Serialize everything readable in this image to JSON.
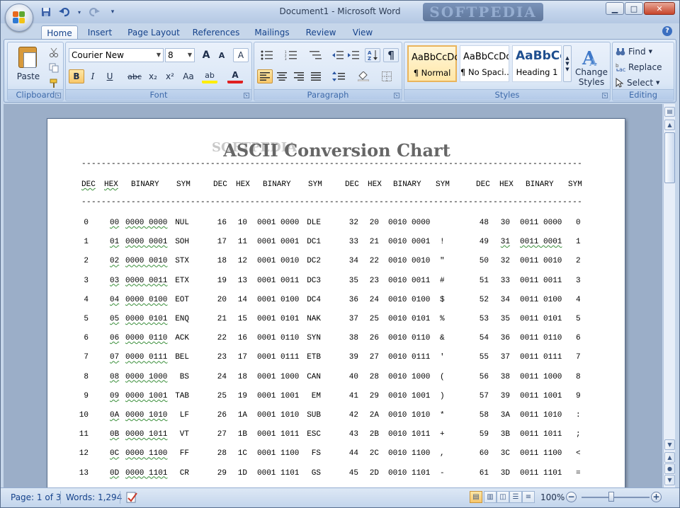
{
  "window": {
    "title": "Document1 - Microsoft Word",
    "watermark": "SOFTPEDIA",
    "controls": {
      "minimize": "▁",
      "maximize": "□",
      "close": "✕"
    }
  },
  "quick_access": {
    "save": "save-icon",
    "undo": "undo-icon",
    "redo": "redo-icon",
    "more": "▾"
  },
  "tabs": [
    "Home",
    "Insert",
    "Page Layout",
    "References",
    "Mailings",
    "Review",
    "View"
  ],
  "help": "?",
  "ribbon": {
    "clipboard": {
      "paste_label": "Paste",
      "group_label": "Clipboard"
    },
    "font": {
      "font_name": "Courier New",
      "font_size": "8",
      "grow": "A",
      "shrink": "A",
      "clear": "A",
      "bold": "B",
      "italic": "I",
      "underline": "U",
      "strike": "abc",
      "subscript": "x₂",
      "superscript": "x²",
      "change_case": "Aa",
      "highlight": "ab",
      "font_color": "A",
      "group_label": "Font"
    },
    "paragraph": {
      "pilcrow": "¶",
      "group_label": "Paragraph"
    },
    "styles": {
      "items": [
        {
          "sample": "AaBbCcDc",
          "name": "¶ Normal"
        },
        {
          "sample": "AaBbCcDc",
          "name": "¶ No Spaci..."
        },
        {
          "sample": "AaBbCc",
          "name": "Heading 1"
        }
      ],
      "change_styles": "Change Styles",
      "change_styles_line1": "Change",
      "change_styles_line2": "Styles",
      "group_label": "Styles"
    },
    "editing": {
      "find": "Find",
      "replace": "Replace",
      "select": "Select",
      "group_label": "Editing"
    }
  },
  "document": {
    "page_watermark": "SOFTPEDIA",
    "title": "ASCII Conversion Chart",
    "header": [
      "DEC",
      "HEX",
      "BINARY",
      "SYM",
      "DEC",
      "HEX",
      "BINARY",
      "SYM",
      "DEC",
      "HEX",
      "BINARY",
      "SYM",
      "DEC",
      "HEX",
      "BINARY",
      "SYM"
    ],
    "rows": [
      [
        "0",
        "00",
        "0000 0000",
        "NUL",
        "16",
        "10",
        "0001 0000",
        "DLE",
        "32",
        "20",
        "0010 0000",
        "",
        "48",
        "30",
        "0011 0000",
        "0"
      ],
      [
        "1",
        "01",
        "0000 0001",
        "SOH",
        "17",
        "11",
        "0001 0001",
        "DC1",
        "33",
        "21",
        "0010 0001",
        "!",
        "49",
        "31",
        "0011 0001",
        "1"
      ],
      [
        "2",
        "02",
        "0000 0010",
        "STX",
        "18",
        "12",
        "0001 0010",
        "DC2",
        "34",
        "22",
        "0010 0010",
        "\"",
        "50",
        "32",
        "0011 0010",
        "2"
      ],
      [
        "3",
        "03",
        "0000 0011",
        "ETX",
        "19",
        "13",
        "0001 0011",
        "DC3",
        "35",
        "23",
        "0010 0011",
        "#",
        "51",
        "33",
        "0011 0011",
        "3"
      ],
      [
        "4",
        "04",
        "0000 0100",
        "EOT",
        "20",
        "14",
        "0001 0100",
        "DC4",
        "36",
        "24",
        "0010 0100",
        "$",
        "52",
        "34",
        "0011 0100",
        "4"
      ],
      [
        "5",
        "05",
        "0000 0101",
        "ENQ",
        "21",
        "15",
        "0001 0101",
        "NAK",
        "37",
        "25",
        "0010 0101",
        "%",
        "53",
        "35",
        "0011 0101",
        "5"
      ],
      [
        "6",
        "06",
        "0000 0110",
        "ACK",
        "22",
        "16",
        "0001 0110",
        "SYN",
        "38",
        "26",
        "0010 0110",
        "&",
        "54",
        "36",
        "0011 0110",
        "6"
      ],
      [
        "7",
        "07",
        "0000 0111",
        "BEL",
        "23",
        "17",
        "0001 0111",
        "ETB",
        "39",
        "27",
        "0010 0111",
        "'",
        "55",
        "37",
        "0011 0111",
        "7"
      ],
      [
        "8",
        "08",
        "0000 1000",
        "BS",
        "24",
        "18",
        "0001 1000",
        "CAN",
        "40",
        "28",
        "0010 1000",
        "(",
        "56",
        "38",
        "0011 1000",
        "8"
      ],
      [
        "9",
        "09",
        "0000 1001",
        "TAB",
        "25",
        "19",
        "0001 1001",
        "EM",
        "41",
        "29",
        "0010 1001",
        ")",
        "57",
        "39",
        "0011 1001",
        "9"
      ],
      [
        "10",
        "0A",
        "0000 1010",
        "LF",
        "26",
        "1A",
        "0001 1010",
        "SUB",
        "42",
        "2A",
        "0010 1010",
        "*",
        "58",
        "3A",
        "0011 1010",
        ":"
      ],
      [
        "11",
        "0B",
        "0000 1011",
        "VT",
        "27",
        "1B",
        "0001 1011",
        "ESC",
        "43",
        "2B",
        "0010 1011",
        "+",
        "59",
        "3B",
        "0011 1011",
        ";"
      ],
      [
        "12",
        "0C",
        "0000 1100",
        "FF",
        "28",
        "1C",
        "0001 1100",
        "FS",
        "44",
        "2C",
        "0010 1100",
        ",",
        "60",
        "3C",
        "0011 1100",
        "<"
      ],
      [
        "13",
        "0D",
        "0000 1101",
        "CR",
        "29",
        "1D",
        "0001 1101",
        "GS",
        "45",
        "2D",
        "0010 1101",
        "-",
        "61",
        "3D",
        "0011 1101",
        "="
      ]
    ]
  },
  "status": {
    "page": "Page: 1 of 3",
    "words": "Words: 1,294",
    "zoom": "100%",
    "zoom_out": "−",
    "zoom_in": "+"
  }
}
